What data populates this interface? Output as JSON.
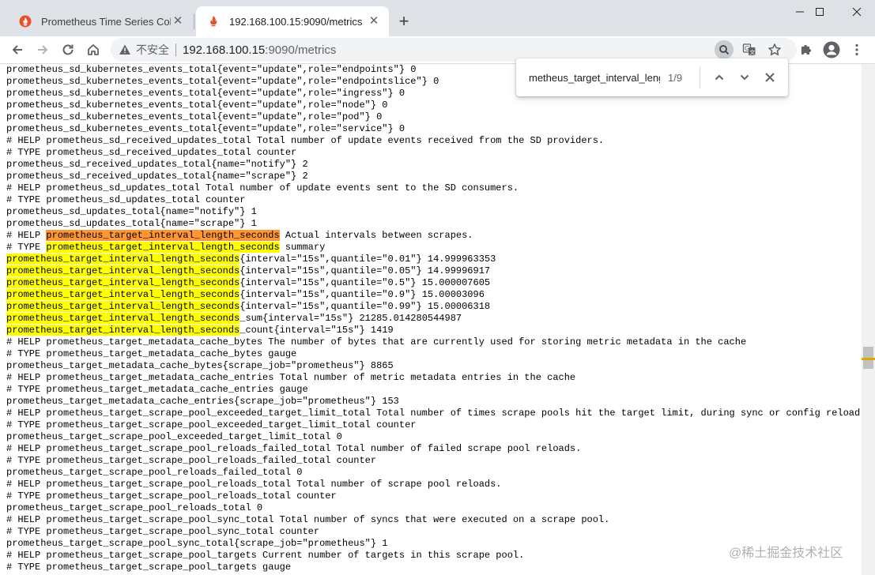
{
  "tabs": [
    {
      "title": "Prometheus Time Series Collection",
      "active": false
    },
    {
      "title": "192.168.100.15:9090/metrics",
      "active": true
    }
  ],
  "toolbar": {
    "security_label": "不安全",
    "url_host": "192.168.100.15",
    "url_rest": ":9090/metrics"
  },
  "find": {
    "query": "metheus_target_interval_length_seconds",
    "count": "1/9"
  },
  "colors": {
    "highlight": "#ffff00",
    "current_highlight": "#ff9632"
  },
  "metrics_lines": [
    "prometheus_sd_kubernetes_events_total{event=\"update\",role=\"endpoints\"} 0",
    "prometheus_sd_kubernetes_events_total{event=\"update\",role=\"endpointslice\"} 0",
    "prometheus_sd_kubernetes_events_total{event=\"update\",role=\"ingress\"} 0",
    "prometheus_sd_kubernetes_events_total{event=\"update\",role=\"node\"} 0",
    "prometheus_sd_kubernetes_events_total{event=\"update\",role=\"pod\"} 0",
    "prometheus_sd_kubernetes_events_total{event=\"update\",role=\"service\"} 0",
    "# HELP prometheus_sd_received_updates_total Total number of update events received from the SD providers.",
    "# TYPE prometheus_sd_received_updates_total counter",
    "prometheus_sd_received_updates_total{name=\"notify\"} 2",
    "prometheus_sd_received_updates_total{name=\"scrape\"} 2",
    "# HELP prometheus_sd_updates_total Total number of update events sent to the SD consumers.",
    "# TYPE prometheus_sd_updates_total counter",
    "prometheus_sd_updates_total{name=\"notify\"} 1",
    "prometheus_sd_updates_total{name=\"scrape\"} 1",
    "# HELP prometheus_target_interval_length_seconds Actual intervals between scrapes.",
    "# TYPE prometheus_target_interval_length_seconds summary",
    "prometheus_target_interval_length_seconds{interval=\"15s\",quantile=\"0.01\"} 14.999963353",
    "prometheus_target_interval_length_seconds{interval=\"15s\",quantile=\"0.05\"} 14.99996917",
    "prometheus_target_interval_length_seconds{interval=\"15s\",quantile=\"0.5\"} 15.000007605",
    "prometheus_target_interval_length_seconds{interval=\"15s\",quantile=\"0.9\"} 15.00003096",
    "prometheus_target_interval_length_seconds{interval=\"15s\",quantile=\"0.99\"} 15.00006318",
    "prometheus_target_interval_length_seconds_sum{interval=\"15s\"} 21285.014280544987",
    "prometheus_target_interval_length_seconds_count{interval=\"15s\"} 1419",
    "# HELP prometheus_target_metadata_cache_bytes The number of bytes that are currently used for storing metric metadata in the cache",
    "# TYPE prometheus_target_metadata_cache_bytes gauge",
    "prometheus_target_metadata_cache_bytes{scrape_job=\"prometheus\"} 8865",
    "# HELP prometheus_target_metadata_cache_entries Total number of metric metadata entries in the cache",
    "# TYPE prometheus_target_metadata_cache_entries gauge",
    "prometheus_target_metadata_cache_entries{scrape_job=\"prometheus\"} 153",
    "# HELP prometheus_target_scrape_pool_exceeded_target_limit_total Total number of times scrape pools hit the target limit, during sync or config reload.",
    "# TYPE prometheus_target_scrape_pool_exceeded_target_limit_total counter",
    "prometheus_target_scrape_pool_exceeded_target_limit_total 0",
    "# HELP prometheus_target_scrape_pool_reloads_failed_total Total number of failed scrape pool reloads.",
    "# TYPE prometheus_target_scrape_pool_reloads_failed_total counter",
    "prometheus_target_scrape_pool_reloads_failed_total 0",
    "# HELP prometheus_target_scrape_pool_reloads_total Total number of scrape pool reloads.",
    "# TYPE prometheus_target_scrape_pool_reloads_total counter",
    "prometheus_target_scrape_pool_reloads_total 0",
    "# HELP prometheus_target_scrape_pool_sync_total Total number of syncs that were executed on a scrape pool.",
    "# TYPE prometheus_target_scrape_pool_sync_total counter",
    "prometheus_target_scrape_pool_sync_total{scrape_job=\"prometheus\"} 1",
    "# HELP prometheus_target_scrape_pool_targets Current number of targets in this scrape pool.",
    "# TYPE prometheus_target_scrape_pool_targets gauge"
  ],
  "highlight_term": "prometheus_target_interval_length_seconds",
  "watermark": "@稀土掘金技术社区"
}
